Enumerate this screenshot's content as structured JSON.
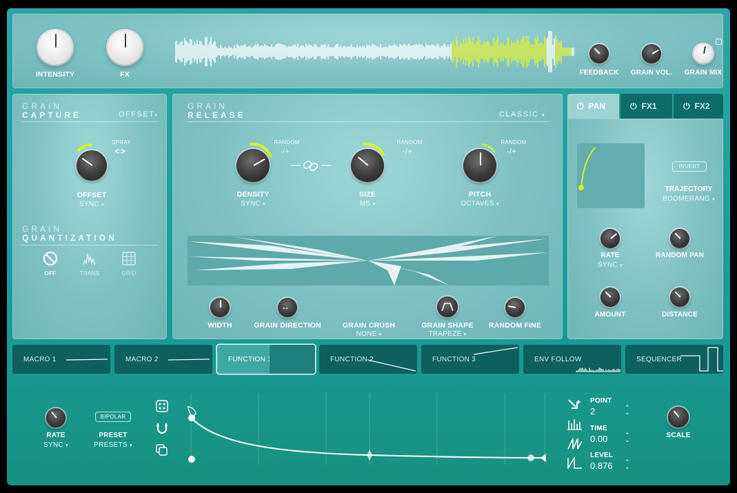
{
  "top": {
    "intensity": "INTENSITY",
    "fx": "FX",
    "feedback": "FEEDBACK",
    "grain_vol": "GRAIN VOL.",
    "grain_mix": "GRAIN MIX"
  },
  "capture": {
    "t1": "GRAIN",
    "t2": "CAPTURE",
    "mode": "OFFSET",
    "spray": "SPRAY",
    "spray_icon": "<>",
    "offset": "OFFSET",
    "offset_sub": "SYNC"
  },
  "quant": {
    "t1": "GRAIN",
    "t2": "QUANTIZATION",
    "off": "OFF",
    "trans": "TRANS",
    "grid": "GRID"
  },
  "release": {
    "t1": "GRAIN",
    "t2": "RELEASE",
    "mode": "CLASSIC",
    "random": "RANDOM",
    "plusminus": "-/+",
    "density": "DENSITY",
    "density_sub": "SYNC",
    "size": "SIZE",
    "size_sub": "MS",
    "pitch": "PITCH",
    "pitch_sub": "OCTAVES",
    "width": "WIDTH",
    "grain_direction": "GRAIN DIRECTION",
    "grain_crush": "GRAIN CRUSH",
    "grain_crush_sub": "NONE",
    "grain_shape": "GRAIN SHAPE",
    "grain_shape_sub": "TRAPEZE",
    "random_fine": "RANDOM FINE"
  },
  "pan": {
    "tabs": [
      "PAN",
      "FX1",
      "FX2"
    ],
    "invert": "INVERT",
    "trajectory": "TRAJECTORY",
    "trajectory_sub": "BOOMERANG",
    "rate": "RATE",
    "rate_sub": "SYNC",
    "random_pan": "RANDOM PAN",
    "amount": "AMOUNT",
    "distance": "DISTANCE"
  },
  "mod_tabs": [
    "MACRO 1",
    "MACRO 2",
    "FUNCTION 1",
    "FUNCTION 2",
    "FUNCTION 3",
    "ENV FOLLOW",
    "SEQUENCER"
  ],
  "func": {
    "rate": "RATE",
    "rate_sub": "SYNC",
    "bipolar": "BIPOLAR",
    "preset": "PRESET",
    "preset_sub": "PRESETS",
    "point_label": "POINT",
    "point": "2",
    "time_label": "TIME",
    "time": "0.00",
    "level_label": "LEVEL",
    "level": "0.876",
    "scale": "SCALE"
  },
  "colors": {
    "accent": "#d8f02a",
    "panel": "#7fc1c2",
    "tab_dark": "#0d5f60"
  }
}
